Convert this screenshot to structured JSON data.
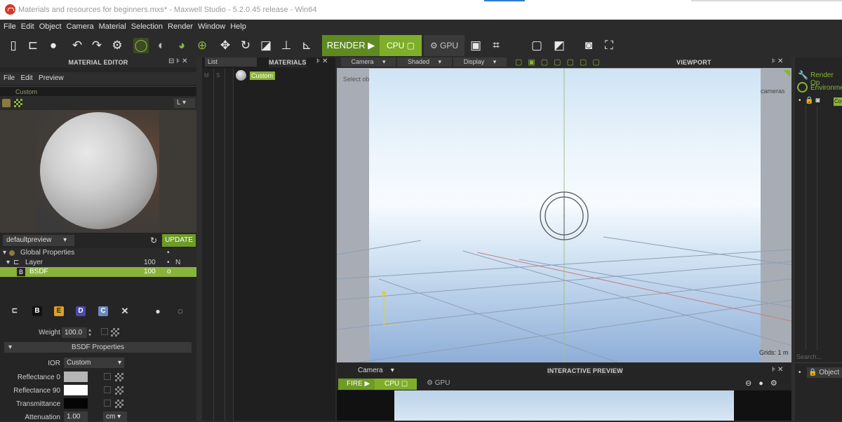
{
  "window": {
    "title": "Materials and resources for beginners.mxs* - Maxwell Studio - 5.2.0.45 release - Win64"
  },
  "menu": [
    "File",
    "Edit",
    "Object",
    "Camera",
    "Material",
    "Selection",
    "Render",
    "Window",
    "Help"
  ],
  "toolbar": {
    "render_label": "RENDER",
    "cpu_label": "CPU",
    "gpu_label": "GPU"
  },
  "material_editor": {
    "header": "MATERIAL EDITOR",
    "menu": [
      "File",
      "Edit",
      "Preview"
    ],
    "material_name": "Custom",
    "size_option": "L",
    "preview_scene": "defaultpreview",
    "update_label": "UPDATE",
    "tree": [
      {
        "label": "Global Properties",
        "value": "",
        "flag1": "•",
        "flag2": ""
      },
      {
        "label": "Layer",
        "value": "100",
        "flag1": "•",
        "flag2": "N"
      },
      {
        "label": "BSDF",
        "value": "100",
        "flag1": "o",
        "flag2": ""
      }
    ],
    "component_buttons": [
      "B",
      "E",
      "D",
      "C"
    ],
    "weight_label": "Weight",
    "weight_value": "100.0",
    "bsdf_section": "BSDF Properties",
    "ior_label": "IOR",
    "ior_value": "Custom",
    "reflectance0_label": "Reflectance 0",
    "reflectance90_label": "Reflectance 90",
    "transmittance_label": "Transmittance",
    "attenuation_label": "Attenuation",
    "attenuation_value": "1.00",
    "attenuation_unit": "cm",
    "colors": {
      "reflectance0": "#b5b5b5",
      "reflectance90": "#ffffff",
      "transmittance": "#050505"
    }
  },
  "materials_panel": {
    "view": "List",
    "header": "MATERIALS",
    "col_m": "M",
    "col_s": "S",
    "item": "Custom"
  },
  "viewport": {
    "header": "VIEWPORT",
    "camera": "Camera",
    "shading": "Shaded",
    "display": "Display",
    "status": "Select ob",
    "camera_label": "cameras",
    "grid_label": "Grids: 1 m"
  },
  "right_panel": {
    "render_options": "Render Op",
    "environment": "Environme",
    "item": "Co",
    "search_placeholder": "Search...",
    "object_label": "Object"
  },
  "interactive_preview": {
    "camera": "Camera",
    "header": "INTERACTIVE PREVIEW",
    "fire_label": "FIRE",
    "cpu_label": "CPU",
    "gpu_label": "GPU"
  },
  "accent": "#7fae2b"
}
